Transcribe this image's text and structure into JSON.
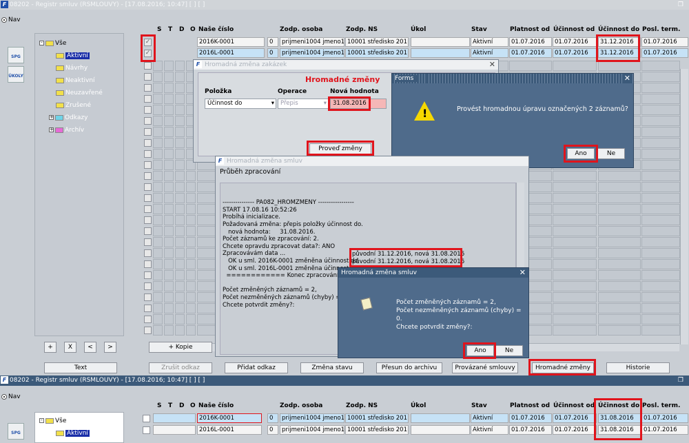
{
  "window": {
    "title": "08202 - Registr smluv (RSMLOUVY) - [17.08.2016; 10:47]  [ ]  [ ]",
    "nav_label": "Nav",
    "tool1": "SPG",
    "tool2": "ÚKOLY"
  },
  "tree": [
    {
      "label": "Vše",
      "kind": "folder"
    },
    {
      "label": "Aktivní",
      "kind": "folder",
      "selected": true
    },
    {
      "label": "Návrhy",
      "kind": "folder"
    },
    {
      "label": "Neaktivní",
      "kind": "folder"
    },
    {
      "label": "Neuzavřené",
      "kind": "folder"
    },
    {
      "label": "Zrušené",
      "kind": "folder"
    },
    {
      "label": "Odkazy",
      "kind": "cyan"
    },
    {
      "label": "Archív",
      "kind": "pink"
    }
  ],
  "columns": {
    "s": "S",
    "t": "T",
    "d": "D",
    "o": "O",
    "cislo": "Naše číslo",
    "osoba": "Zodp. osoba",
    "ns": "Zodp. NS",
    "ukol": "Úkol",
    "stav": "Stav",
    "platnost": "Platnost od",
    "ucinnost_od": "Účinnost od",
    "ucinnost_do": "Účinnost do",
    "posl": "Posl. term."
  },
  "rows_top": [
    {
      "cislo": "2016K-0001",
      "num": "0",
      "osoba": "prijmeni1004 jmeno10",
      "ns": "10001 středisko 201",
      "ukol": "",
      "stav": "Aktivní",
      "platnost": "01.07.2016",
      "ucinnost_od": "01.07.2016",
      "ucinnost_do": "31.12.2016",
      "posl": "01.07.2016"
    },
    {
      "cislo": "2016L-0001",
      "num": "0",
      "osoba": "prijmeni1004 jmeno10",
      "ns": "10001 středisko 201",
      "ukol": "",
      "stav": "Aktivní",
      "platnost": "01.07.2016",
      "ucinnost_od": "01.07.2016",
      "ucinnost_do": "31.12.2016",
      "posl": "01.07.2016"
    }
  ],
  "rows_bottom": [
    {
      "cislo": "2016K-0001",
      "num": "0",
      "osoba": "prijmeni1004 jmeno10",
      "ns": "10001 středisko 201",
      "ukol": "",
      "stav": "Aktivní",
      "platnost": "01.07.2016",
      "ucinnost_od": "01.07.2016",
      "ucinnost_do": "31.08.2016",
      "posl": "01.07.2016"
    },
    {
      "cislo": "2016L-0001",
      "num": "0",
      "osoba": "prijmeni1004 jmeno10",
      "ns": "10001 středisko 201",
      "ukol": "",
      "stav": "Aktivní",
      "platnost": "01.07.2016",
      "ucinnost_od": "01.07.2016",
      "ucinnost_do": "31.08.2016",
      "posl": "01.07.2016"
    }
  ],
  "tree_buttons": [
    "+",
    "X",
    "<",
    ">"
  ],
  "buttons": {
    "kopie": "+ Kopie",
    "text": "Text",
    "zrusit": "Zrušit odkaz",
    "pridat": "Přidat odkaz",
    "zmena": "Změna stavu",
    "presun": "Přesun do archivu",
    "provazane": "Provázané smlouvy",
    "hromadne": "Hromadné změny",
    "historie": "Historie"
  },
  "dlg_zakazek": {
    "title": "Hromadná změna zakázek",
    "heading": "Hromadné změny",
    "col_polozka": "Položka",
    "col_operace": "Operace",
    "col_hodnota": "Nová hodnota",
    "polozka_value": "Účinnost do",
    "operace_value": "Přepis",
    "hodnota_value": "31.08.2016",
    "run_button": "Proveď změny"
  },
  "dlg_forms": {
    "title": "Forms",
    "message": "Provést hromadnou úpravu označených 2 záznamů?",
    "yes": "Ano",
    "no": "Ne"
  },
  "dlg_progress": {
    "title": "Hromadná změna smluv",
    "subtitle": "Průběh zpracování",
    "log": [
      "--------------- PA082_HROMZMENY -----------------",
      "START 17.08.16 10:52:26",
      "Probíhá inicializace.",
      "Požadovaná změna: přepis položky účinnost do.",
      "   nová hodnota:     31.08.2016.",
      "Počet záznamů ke zpracování: 2.",
      "Chcete opravdu zpracovat data?: ANO",
      "Zpracovávám data ...",
      "   OK u sml. 2016K-0001 změněna účinnost do",
      "   OK u sml. 2016L-0001 změněna účinnost do",
      "  ============ Konec zpracování ====",
      "",
      "Počet změněných záznamů = 2,",
      "Počet nezměněných záznamů (chyby) = 0",
      "Chcete potvrdit změny?:"
    ],
    "change1": "původní 31.12.2016, nová 31.08.2016",
    "change2": "původní 31.12.2016, nová 31.08.2016"
  },
  "dlg_confirm": {
    "title": "Hromadná změna smluv",
    "line1": "Počet změněných záznamů = 2,",
    "line2": "Počet nezměněných záznamů (chyby) = 0.",
    "line3": "Chcete potvrdit změny?:",
    "yes": "Ano",
    "no": "Ne"
  },
  "colors": {
    "dialog_blue": "#4f6b8b",
    "highlight": "#e0141c",
    "selection": "#1a2ea8"
  }
}
